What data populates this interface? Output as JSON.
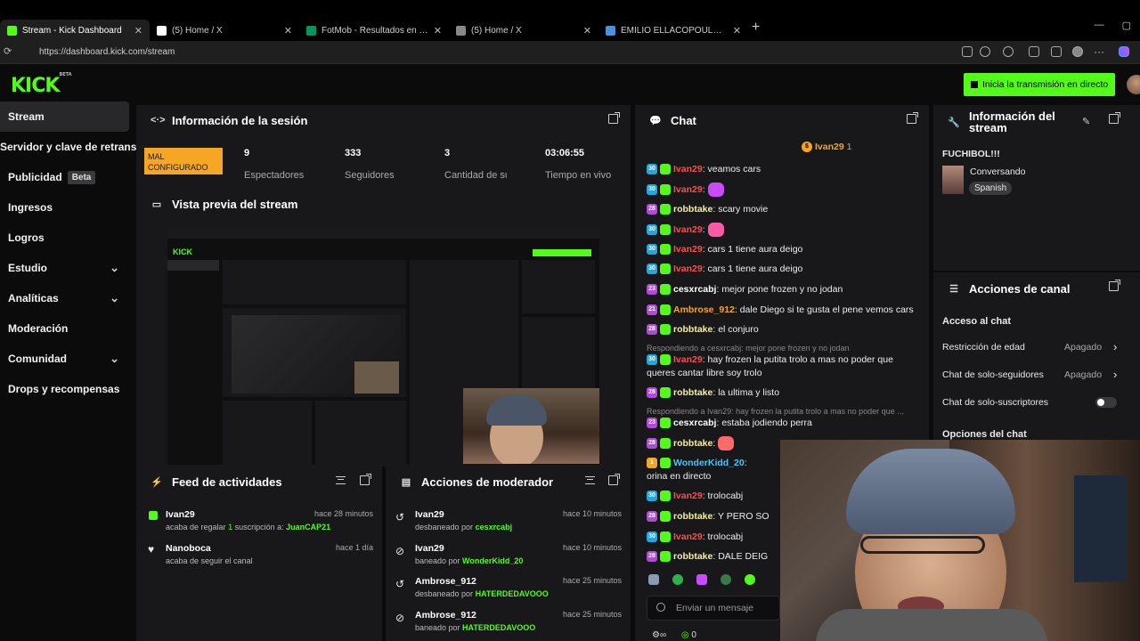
{
  "browser": {
    "tabs": [
      {
        "label": "Stream - Kick Dashboard",
        "color": "#53fc18",
        "active": true
      },
      {
        "label": "(5) Home / X",
        "color": "#ffffff"
      },
      {
        "label": "FotMob - Resultados en vivo de fútbol",
        "color": "#00985f"
      },
      {
        "label": "(5) Home / X",
        "color": "#888888"
      },
      {
        "label": "EMILIO ELLACOPOULOS - Búsqueda",
        "color": "#4a90e2"
      }
    ],
    "url": "https://dashboard.kick.com/stream"
  },
  "app": {
    "logo": "KICK",
    "logo_tag": "BETA",
    "go_live": "Inicia la transmisión en directo",
    "accent": "#53fc18"
  },
  "sidebar": [
    {
      "label": "Stream",
      "active": true
    },
    {
      "label": "Servidor y clave de retransmisión"
    },
    {
      "label": "Publicidad",
      "badge": "Beta"
    },
    {
      "label": "Ingresos"
    },
    {
      "label": "Logros"
    },
    {
      "label": "Estudio",
      "chevron": true
    },
    {
      "label": "Analíticas",
      "chevron": true
    },
    {
      "label": "Moderación"
    },
    {
      "label": "Comunidad",
      "chevron": true
    },
    {
      "label": "Drops y recompensas"
    }
  ],
  "session": {
    "title": "Información de la sesión",
    "badge": "MAL CONFIGURADO",
    "stats": [
      {
        "value": "9",
        "label": "Espectadores"
      },
      {
        "value": "333",
        "label": "Seguidores"
      },
      {
        "value": "3",
        "label": "Cantidad de suscripciones"
      },
      {
        "value": "03:06:55",
        "label": "Tiempo en vivo"
      }
    ]
  },
  "preview": {
    "title": "Vista previa del stream"
  },
  "feed": {
    "title": "Feed de actividades",
    "items": [
      {
        "name": "Ivan29",
        "time": "hace 28 minutos",
        "prefix": "acaba de regalar ",
        "count": "1",
        "mid": " suscripción a: ",
        "target": "JuanCAP21"
      },
      {
        "name": "Nanoboca",
        "time": "hace 1 día",
        "text": "acaba de seguir el canal"
      }
    ]
  },
  "modactions": {
    "title": "Acciones de moderador",
    "items": [
      {
        "name": "Ivan29",
        "time": "hace 10 minutos",
        "action": "desbaneado por ",
        "by": "cesxrcabj"
      },
      {
        "name": "Ivan29",
        "time": "hace 10 minutos",
        "action": "baneado por ",
        "by": "WonderKidd_20"
      },
      {
        "name": "Ambrose_912",
        "time": "hace 25 minutos",
        "action": "desbaneado por ",
        "by": "HATERDEDAVOOO"
      },
      {
        "name": "Ambrose_912",
        "time": "hace 25 minutos",
        "action": "baneado por ",
        "by": "HATERDEDAVOOO"
      }
    ]
  },
  "chat": {
    "title": "Chat",
    "pinned_user": "Ivan29",
    "pinned_count": "1",
    "placeholder": "Enviar un mensaje",
    "footer_count": "0",
    "messages": [
      {
        "badge": "30",
        "bc": "#1ea7e1",
        "user": "Ivan29",
        "uc": "#ff4d4d",
        "text": "veamos cars"
      },
      {
        "badge": "30",
        "bc": "#1ea7e1",
        "user": "Ivan29",
        "uc": "#ff4d4d",
        "emote": "#c84bff"
      },
      {
        "badge": "28",
        "bc": "#b04bd8",
        "user": "robbtake",
        "uc": "#f5f0a0",
        "text": "scary movie"
      },
      {
        "badge": "30",
        "bc": "#1ea7e1",
        "user": "Ivan29",
        "uc": "#ff4d4d",
        "emote": "#ff5aa5"
      },
      {
        "badge": "30",
        "bc": "#1ea7e1",
        "user": "Ivan29",
        "uc": "#ff4d4d",
        "text": "cars 1 tiene aura deigo"
      },
      {
        "badge": "30",
        "bc": "#1ea7e1",
        "user": "Ivan29",
        "uc": "#ff4d4d",
        "text": "cars 1 tiene aura deigo"
      },
      {
        "badge": "23",
        "bc": "#b04bd8",
        "user": "cesxrcabj",
        "uc": "#ffffff",
        "text": "mejor pone frozen y no jodan"
      },
      {
        "badge": "21",
        "bc": "#b04bd8",
        "user": "Ambrose_912",
        "uc": "#f5a623",
        "text": "dale Diego si te gusta el pene vemos cars"
      },
      {
        "badge": "28",
        "bc": "#b04bd8",
        "user": "robbtake",
        "uc": "#f5f0a0",
        "text": "el conjuro"
      },
      {
        "reply": "Respondiendo a cesxrcabj: mejor pone frozen y no jodan"
      },
      {
        "badge": "30",
        "bc": "#1ea7e1",
        "user": "Ivan29",
        "uc": "#ff4d4d",
        "text": "hay frozen la putita trolo a mas no poder que",
        "text2": "queres cantar libre soy trolo"
      },
      {
        "badge": "28",
        "bc": "#b04bd8",
        "user": "robbtake",
        "uc": "#f5f0a0",
        "text": "la ultima y listo"
      },
      {
        "reply": "Respondiendo a Ivan29: hay frozen la putita trolo a mas no poder que ..."
      },
      {
        "badge": "23",
        "bc": "#b04bd8",
        "user": "cesxrcabj",
        "uc": "#ffffff",
        "text": "estaba jodiendo perra"
      },
      {
        "badge": "28",
        "bc": "#b04bd8",
        "user": "robbtake",
        "uc": "#f5f0a0",
        "emote": "#ff6b6b"
      },
      {
        "badge": "1",
        "bc": "#f5a623",
        "user": "WonderKidd_20",
        "uc": "#4fc3f7",
        "text": "",
        "text2": "orina en directo"
      },
      {
        "badge": "30",
        "bc": "#1ea7e1",
        "user": "Ivan29",
        "uc": "#ff4d4d",
        "text": "trolocabj"
      },
      {
        "badge": "28",
        "bc": "#b04bd8",
        "user": "robbtake",
        "uc": "#f5f0a0",
        "text": "Y PERO SO"
      },
      {
        "badge": "30",
        "bc": "#1ea7e1",
        "user": "Ivan29",
        "uc": "#ff4d4d",
        "text": "trolocabj"
      },
      {
        "badge": "28",
        "bc": "#b04bd8",
        "user": "robbtake",
        "uc": "#f5f0a0",
        "text": "DALE DEIG"
      }
    ]
  },
  "streaminfo": {
    "title": "Información del stream",
    "stream_title": "FUCHIBOL!!!",
    "category": "Conversando",
    "language": "Spanish"
  },
  "channel": {
    "title": "Acciones de canal",
    "section": "Acceso al chat",
    "rows": [
      {
        "label": "Restricción de edad",
        "value": "Apagado"
      },
      {
        "label": "Chat de solo-seguidores",
        "value": "Apagado"
      },
      {
        "label": "Chat de solo-suscriptores",
        "value": ""
      }
    ],
    "section2": "Opciones del chat"
  }
}
